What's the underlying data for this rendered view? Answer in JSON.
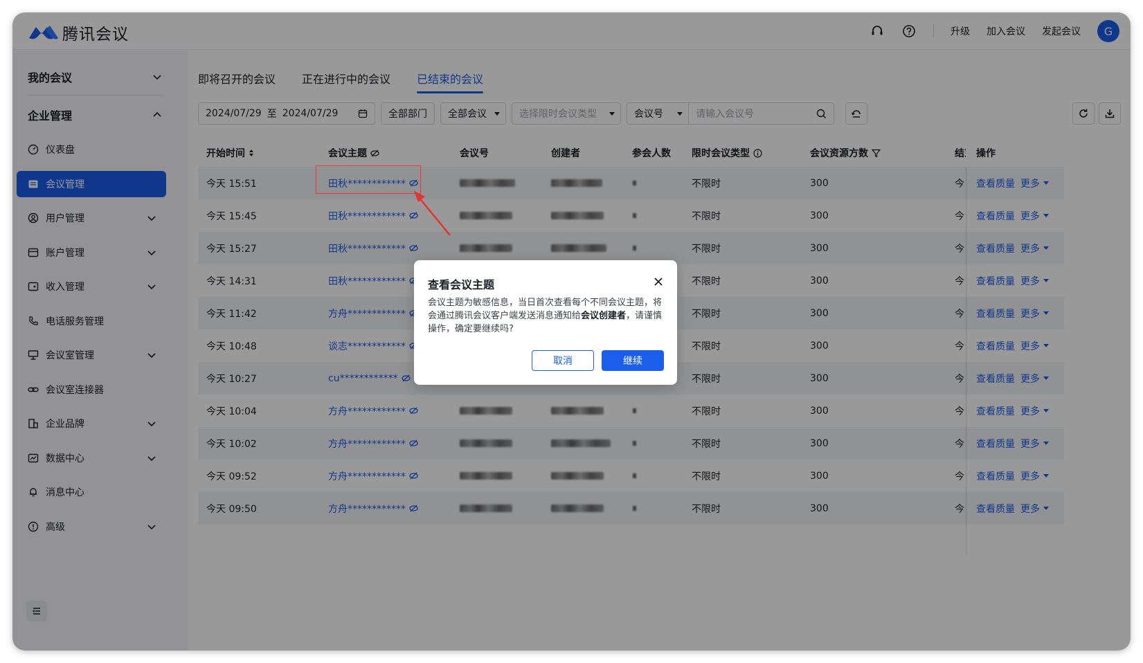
{
  "app": {
    "name": "腾讯会议"
  },
  "header": {
    "upgrade": "升级",
    "join": "加入会议",
    "start": "发起会议",
    "avatar": "G"
  },
  "sidebar": {
    "my_meetings": "我的会议",
    "enterprise": "企业管理",
    "items": [
      {
        "label": "仪表盘",
        "icon": "dashboard-icon",
        "chevron": false,
        "active": false
      },
      {
        "label": "会议管理",
        "icon": "meeting-list-icon",
        "chevron": false,
        "active": true
      },
      {
        "label": "用户管理",
        "icon": "user-icon",
        "chevron": true,
        "active": false
      },
      {
        "label": "账户管理",
        "icon": "account-icon",
        "chevron": true,
        "active": false
      },
      {
        "label": "收入管理",
        "icon": "income-icon",
        "chevron": true,
        "active": false
      },
      {
        "label": "电话服务管理",
        "icon": "phone-icon",
        "chevron": false,
        "active": false
      },
      {
        "label": "会议室管理",
        "icon": "room-icon",
        "chevron": true,
        "active": false
      },
      {
        "label": "会议室连接器",
        "icon": "link-icon",
        "chevron": false,
        "active": false
      },
      {
        "label": "企业品牌",
        "icon": "brand-icon",
        "chevron": true,
        "active": false
      },
      {
        "label": "数据中心",
        "icon": "chart-icon",
        "chevron": true,
        "active": false
      },
      {
        "label": "消息中心",
        "icon": "bell-icon",
        "chevron": false,
        "active": false
      },
      {
        "label": "高级",
        "icon": "advanced-icon",
        "chevron": true,
        "active": false
      }
    ]
  },
  "tabs": [
    {
      "label": "即将召开的会议",
      "active": false
    },
    {
      "label": "正在进行中的会议",
      "active": false
    },
    {
      "label": "已结束的会议",
      "active": true
    }
  ],
  "filters": {
    "date_start": "2024/07/29",
    "date_sep": "至",
    "date_end": "2024/07/29",
    "department": "全部部门",
    "meeting_scope": "全部会议",
    "limit_type_placeholder": "选择限时会议类型",
    "search_field": "会议号",
    "search_placeholder": "请输入会议号"
  },
  "table": {
    "headers": {
      "start_time": "开始时间",
      "topic": "会议主题",
      "meeting_id": "会议号",
      "creator": "创建者",
      "participants": "参会人数",
      "limit_type": "限时会议类型",
      "resources": "会议资源方数",
      "end": "结束",
      "actions": "操作"
    },
    "rows": [
      {
        "start_time": "今天 15:51",
        "topic": "田秋************",
        "limit_type": "不限时",
        "resources": "300",
        "end": "今天"
      },
      {
        "start_time": "今天 15:45",
        "topic": "田秋************",
        "limit_type": "不限时",
        "resources": "300",
        "end": "今天"
      },
      {
        "start_time": "今天 15:27",
        "topic": "田秋************",
        "limit_type": "不限时",
        "resources": "300",
        "end": "今天"
      },
      {
        "start_time": "今天 14:31",
        "topic": "田秋************",
        "limit_type": "不限时",
        "resources": "300",
        "end": "今天"
      },
      {
        "start_time": "今天 11:42",
        "topic": "方舟************",
        "limit_type": "不限时",
        "resources": "300",
        "end": "今天"
      },
      {
        "start_time": "今天 10:48",
        "topic": "谈志************",
        "limit_type": "不限时",
        "resources": "300",
        "end": "今天"
      },
      {
        "start_time": "今天 10:27",
        "topic": "cu************",
        "limit_type": "不限时",
        "resources": "300",
        "end": "今天"
      },
      {
        "start_time": "今天 10:04",
        "topic": "方舟************",
        "limit_type": "不限时",
        "resources": "300",
        "end": "今天"
      },
      {
        "start_time": "今天 10:02",
        "topic": "方舟************",
        "limit_type": "不限时",
        "resources": "300",
        "end": "今天"
      },
      {
        "start_time": "今天 09:52",
        "topic": "方舟************",
        "limit_type": "不限时",
        "resources": "300",
        "end": "今天"
      },
      {
        "start_time": "今天 09:50",
        "topic": "方舟************",
        "limit_type": "不限时",
        "resources": "300",
        "end": "今天"
      }
    ],
    "action_quality": "查看质量",
    "action_more": "更多"
  },
  "modal": {
    "title": "查看会议主题",
    "body_pre": "会议主题为敏感信息，当日首次查看每个不同会议主题，将会通过腾讯会议客户端发送消息通知给",
    "body_bold": "会议创建者",
    "body_post": "，请谨慎操作，确定要继续吗?",
    "cancel": "取消",
    "confirm": "继续"
  },
  "colors": {
    "accent": "#1a5eeb",
    "annotation": "#e33333"
  }
}
